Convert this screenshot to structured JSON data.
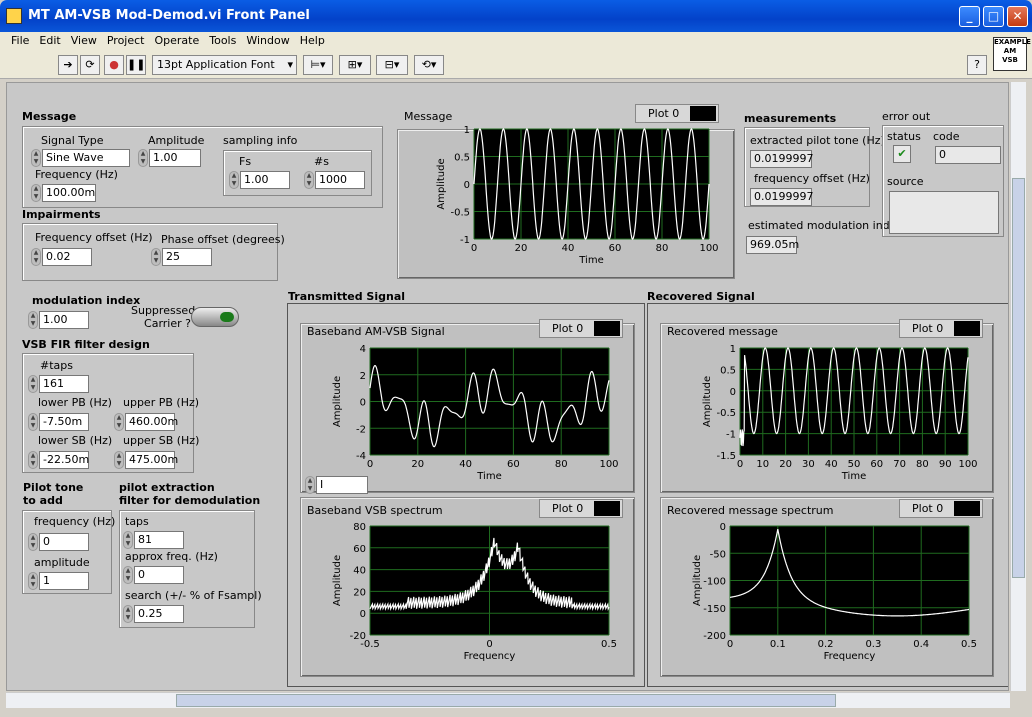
{
  "window": {
    "title": "MT AM-VSB Mod-Demod.vi Front Panel",
    "min": "_",
    "max": "□",
    "close": "✕"
  },
  "menu": [
    "File",
    "Edit",
    "View",
    "Project",
    "Operate",
    "Tools",
    "Window",
    "Help"
  ],
  "toolbar": {
    "font": "13pt Application Font",
    "help": "?",
    "example_badge": "EXAMPLE\nAM\nVSB"
  },
  "message": {
    "title": "Message",
    "signal_type_label": "Signal Type",
    "signal_type": "Sine Wave",
    "amplitude_label": "Amplitude",
    "amplitude": "1.00",
    "frequency_label": "Frequency (Hz)",
    "frequency": "100.00m",
    "sampling_label": "sampling info",
    "fs_label": "Fs",
    "fs": "1.00",
    "ns_label": "#s",
    "ns": "1000"
  },
  "impairments": {
    "title": "Impairments",
    "freq_label": "Frequency offset (Hz)",
    "freq": "0.02",
    "phase_label": "Phase offset (degrees)",
    "phase": "25"
  },
  "modulation": {
    "title": "modulation index",
    "value": "1.00",
    "suppressed_label": "Suppressed Carrier ?"
  },
  "vsb": {
    "title": "VSB FIR filter design",
    "taps_label": "#taps",
    "taps": "161",
    "lower_pb_label": "lower PB (Hz)",
    "lower_pb": "-7.50m",
    "upper_pb_label": "upper PB (Hz)",
    "upper_pb": "460.00m",
    "lower_sb_label": "lower SB (Hz)",
    "lower_sb": "-22.50m",
    "upper_sb_label": "upper SB (Hz)",
    "upper_sb": "475.00m"
  },
  "pilot": {
    "title1": "Pilot tone",
    "title2": "to add",
    "freq_label": "frequency (Hz)",
    "freq": "0",
    "amp_label": "amplitude",
    "amp": "1"
  },
  "pilot_extract": {
    "title1": "pilot extraction",
    "title2": "filter for demodulation",
    "taps_label": "taps",
    "taps": "81",
    "approx_label": "approx freq. (Hz)",
    "approx": "0",
    "search_label": "search (+/- % of Fsampl)",
    "search": "0.25"
  },
  "measurements": {
    "title": "measurements",
    "pilot_label": "extracted pilot tone (Hz)",
    "pilot": "0.0199997",
    "freq_off_label": "frequency offset (Hz)",
    "freq_off": "0.0199997",
    "mod_index_label": "estimated modulation index",
    "mod_index": "969.05m"
  },
  "error": {
    "title": "error out",
    "status_label": "status",
    "code_label": "code",
    "code": "0",
    "source_label": "source"
  },
  "sections": {
    "tx": "Transmitted Signal",
    "rx": "Recovered Signal"
  },
  "graphs": [
    {
      "key": "message",
      "caption": "Message",
      "legend": "Plot 0",
      "xlabel": "Time",
      "ylabel": "Amplitude",
      "xticks": [
        "0",
        "20",
        "40",
        "60",
        "80",
        "100"
      ],
      "yticks": [
        "1",
        "0.5",
        "0",
        "-0.5",
        "-1"
      ]
    },
    {
      "key": "baseband",
      "caption": "Baseband AM-VSB Signal",
      "legend": "Plot 0",
      "xlabel": "Time",
      "ylabel": "Amplitude",
      "xticks": [
        "0",
        "20",
        "40",
        "60",
        "80",
        "100"
      ],
      "yticks": [
        "4",
        "2",
        "0",
        "-2",
        "-4"
      ],
      "selector": "I"
    },
    {
      "key": "vsbspec",
      "caption": "Baseband VSB spectrum",
      "legend": "Plot 0",
      "xlabel": "Frequency",
      "ylabel": "Amplitude",
      "xticks": [
        "-0.5",
        "0",
        "0.5"
      ],
      "yticks": [
        "80",
        "60",
        "40",
        "20",
        "0",
        "-20"
      ]
    },
    {
      "key": "recmsg",
      "caption": "Recovered message",
      "legend": "Plot 0",
      "xlabel": "Time",
      "ylabel": "Amplitude",
      "xticks": [
        "0",
        "10",
        "20",
        "30",
        "40",
        "50",
        "60",
        "70",
        "80",
        "90",
        "100"
      ],
      "yticks": [
        "1",
        "0.5",
        "0",
        "-0.5",
        "-1",
        "-1.5"
      ]
    },
    {
      "key": "recspec",
      "caption": "Recovered message spectrum",
      "legend": "Plot 0",
      "xlabel": "Frequency",
      "ylabel": "Amplitude",
      "xticks": [
        "0",
        "0.1",
        "0.2",
        "0.3",
        "0.4",
        "0.5"
      ],
      "yticks": [
        "0",
        "-50",
        "-100",
        "-150",
        "-200"
      ]
    }
  ],
  "chart_data": [
    {
      "type": "line",
      "title": "Message",
      "xlabel": "Time",
      "ylabel": "Amplitude",
      "xlim": [
        0,
        100
      ],
      "ylim": [
        -1,
        1
      ],
      "series": [
        {
          "function": "sine",
          "amplitude": 1,
          "cycles": 10
        }
      ]
    },
    {
      "type": "line",
      "title": "Baseband AM-VSB Signal",
      "xlabel": "Time",
      "ylabel": "Amplitude",
      "xlim": [
        0,
        100
      ],
      "ylim": [
        -4,
        4
      ]
    },
    {
      "type": "line",
      "title": "Baseband VSB spectrum",
      "xlabel": "Frequency",
      "ylabel": "Amplitude",
      "xlim": [
        -0.5,
        0.5
      ],
      "ylim": [
        -20,
        80
      ],
      "peaks": [
        {
          "x": 0.02,
          "y": 62
        },
        {
          "x": 0.12,
          "y": 55
        }
      ]
    },
    {
      "type": "line",
      "title": "Recovered message",
      "xlabel": "Time",
      "ylabel": "Amplitude",
      "xlim": [
        0,
        100
      ],
      "ylim": [
        -1.5,
        1
      ],
      "series": [
        {
          "function": "sine",
          "amplitude": 1,
          "cycles": 10
        }
      ]
    },
    {
      "type": "line",
      "title": "Recovered message spectrum",
      "xlabel": "Frequency",
      "ylabel": "Amplitude",
      "xlim": [
        0,
        0.5
      ],
      "ylim": [
        -200,
        0
      ],
      "peaks": [
        {
          "x": 0.1,
          "y": -10
        }
      ]
    }
  ]
}
